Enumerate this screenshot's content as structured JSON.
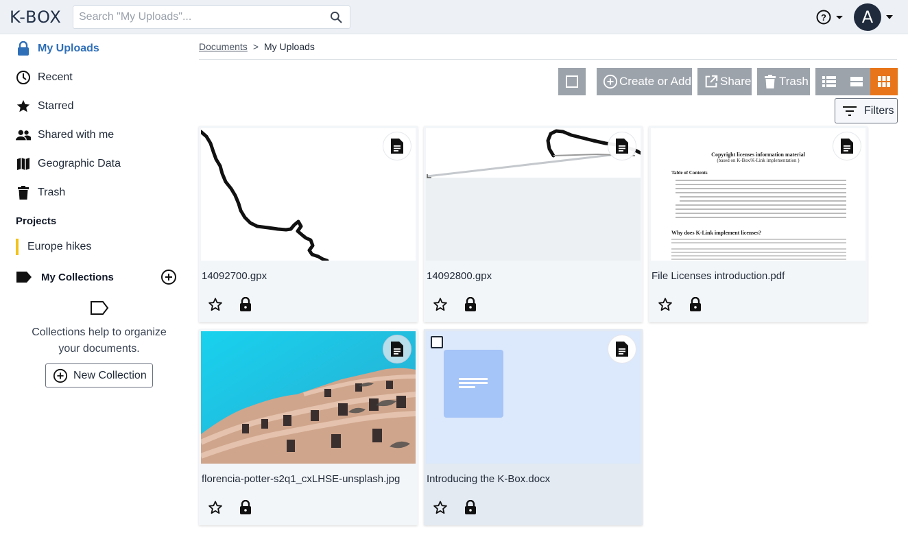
{
  "header": {
    "logo": "K-BOX",
    "search_placeholder": "Search \"My Uploads\"...",
    "avatar_initial": "A"
  },
  "sidebar": {
    "items": [
      {
        "label": "My Uploads",
        "icon": "lock-icon",
        "active": true
      },
      {
        "label": "Recent",
        "icon": "clock-icon"
      },
      {
        "label": "Starred",
        "icon": "star-icon"
      },
      {
        "label": "Shared with me",
        "icon": "people-icon"
      },
      {
        "label": "Geographic Data",
        "icon": "map-icon"
      },
      {
        "label": "Trash",
        "icon": "trash-icon"
      }
    ],
    "projects_title": "Projects",
    "projects": [
      {
        "label": "Europe hikes",
        "color": "#f2c21b"
      }
    ],
    "collections_title": "My Collections",
    "collections_help": "Collections help to organize your documents.",
    "new_collection": "New Collection"
  },
  "breadcrumb": {
    "root": "Documents",
    "separator": ">",
    "current": "My Uploads"
  },
  "toolbar": {
    "create": "Create or Add",
    "share": "Share",
    "trash": "Trash",
    "filters": "Filters",
    "accent": "#e8751a"
  },
  "documents": [
    {
      "name": "14092700.gpx",
      "type": "gpx-track"
    },
    {
      "name": "14092800.gpx",
      "type": "gpx-track"
    },
    {
      "name": "File Licenses introduction.pdf",
      "type": "pdf"
    },
    {
      "name": "florencia-potter-s2q1_cxLHSE-unsplash.jpg",
      "type": "image"
    },
    {
      "name": "Introducing the K-Box.docx",
      "type": "docx",
      "selected": true
    }
  ],
  "pdf_preview": {
    "title": "Copyright licenses information material",
    "subtitle": "(based on K-Box/K-Link implementation )",
    "toc": "Table of Contents",
    "heading": "Why does K-Link implement licenses?"
  }
}
